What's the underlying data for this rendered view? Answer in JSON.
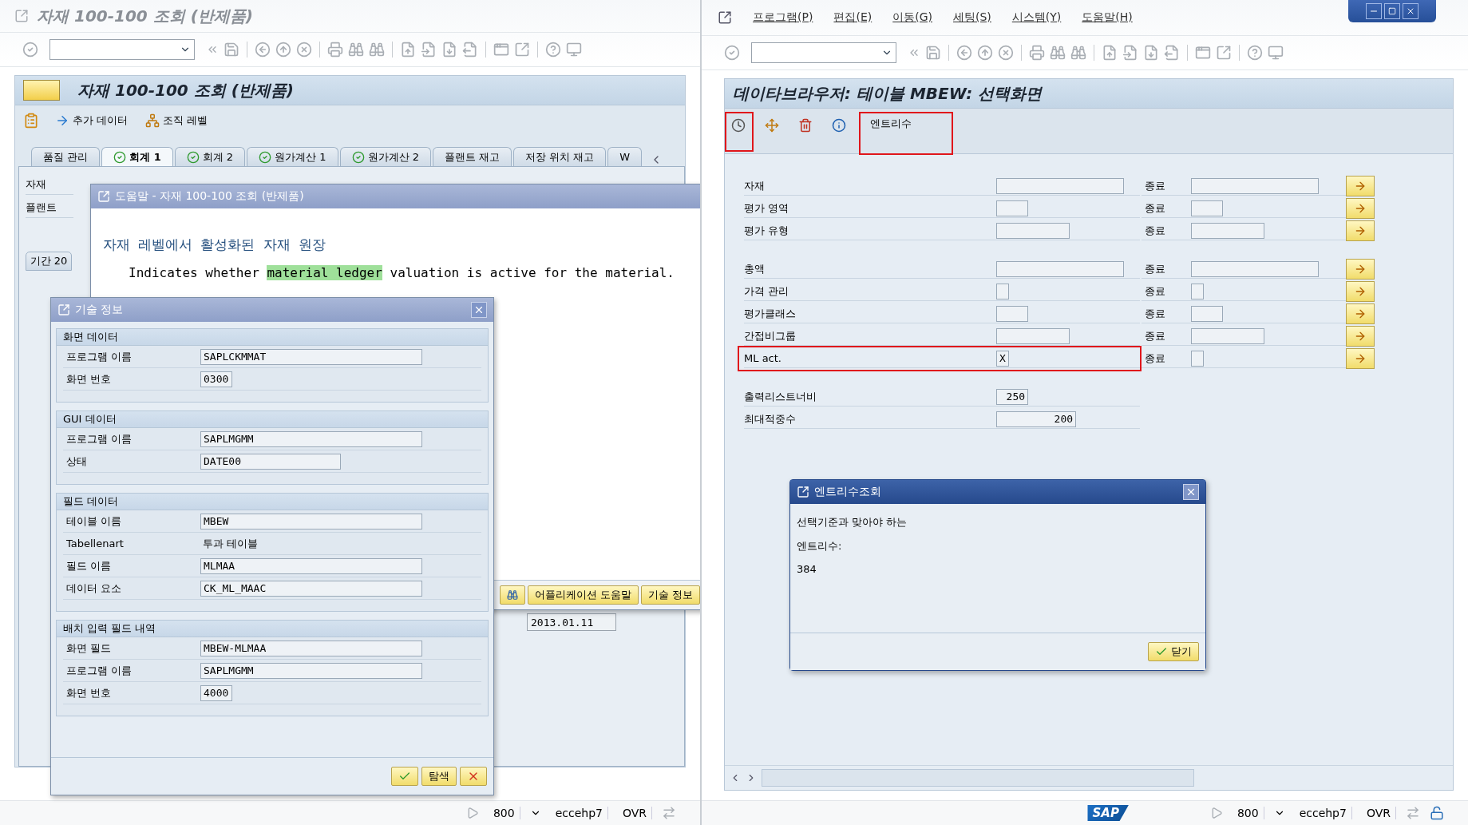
{
  "left_window": {
    "title": "자재 100-100 조회 (반제품)",
    "screen_title": "자재 100-100 조회 (반제품)",
    "app_toolbar": [
      {
        "kind": "arrow",
        "label": "추가 데이터"
      },
      {
        "kind": "org",
        "label": "조직 레벨"
      }
    ],
    "tabs": [
      {
        "label": "품질 관리",
        "selected": false,
        "checked": false
      },
      {
        "label": "회계 1",
        "selected": true,
        "checked": true
      },
      {
        "label": "회계 2",
        "selected": false,
        "checked": true
      },
      {
        "label": "원가계산 1",
        "selected": false,
        "checked": true
      },
      {
        "label": "원가계산 2",
        "selected": false,
        "checked": true
      },
      {
        "label": "플랜트 재고",
        "selected": false,
        "checked": false
      },
      {
        "label": "저장 위치 재고",
        "selected": false,
        "checked": false
      },
      {
        "label": "W",
        "selected": false,
        "checked": false
      }
    ],
    "fields": [
      "자재",
      "플랜트"
    ],
    "subtab": "기간 20",
    "date_value": "2013.01.11",
    "status_bar": {
      "client": "800",
      "system": "eccehp7",
      "mode": "OVR"
    }
  },
  "help_dialog": {
    "title": "도움말 - 자재 100-100 조회 (반제품)",
    "heading": "자재 레벨에서 활성화된 자재 원장",
    "text_before": "Indicates whether ",
    "highlight": "material ledger",
    "text_after": " valuation is active for the material.",
    "buttons": [
      {
        "kind": "binoculars"
      },
      {
        "kind": "text",
        "label": "어플리케이션 도움말"
      },
      {
        "kind": "text",
        "label": "기술 정보"
      }
    ]
  },
  "tech_dialog": {
    "title": "기술 정보",
    "sections": [
      {
        "title": "화면 데이터",
        "rows": [
          {
            "label": "프로그램 이름",
            "value": "SAPLCKMMAT",
            "kind": "long"
          },
          {
            "label": "화면 번호",
            "value": "0300",
            "kind": "short"
          }
        ]
      },
      {
        "title": "GUI 데이터",
        "rows": [
          {
            "label": "프로그램 이름",
            "value": "SAPLMGMM",
            "kind": "long"
          },
          {
            "label": "상태",
            "value": "DATE00",
            "kind": "medium"
          }
        ]
      },
      {
        "title": "필드 데이터",
        "rows": [
          {
            "label": "테이블 이름",
            "value": "MBEW",
            "kind": "long"
          },
          {
            "label": "Tabellenart",
            "value": "투과 테이블",
            "kind": "plain"
          },
          {
            "label": "필드 이름",
            "value": "MLMAA",
            "kind": "long"
          },
          {
            "label": "데이터 요소",
            "value": "CK_ML_MAAC",
            "kind": "long"
          }
        ]
      },
      {
        "title": "배치 입력 필드 내역",
        "rows": [
          {
            "label": "화면 필드",
            "value": "MBEW-MLMAA",
            "kind": "long"
          },
          {
            "label": "프로그램 이름",
            "value": "SAPLMGMM",
            "kind": "long"
          },
          {
            "label": "화면 번호",
            "value": "4000",
            "kind": "short"
          }
        ]
      }
    ],
    "buttons": [
      {
        "kind": "confirm"
      },
      {
        "kind": "text",
        "label": "탐색"
      },
      {
        "kind": "cancel"
      }
    ]
  },
  "right_window": {
    "menu": [
      "프로그램(P)",
      "편집(E)",
      "이동(G)",
      "세팅(S)",
      "시스템(Y)",
      "도움말(H)"
    ],
    "screen_title": "데이타브라우저: 테이블 MBEW: 선택화면",
    "toolbar": [
      {
        "kind": "execute",
        "highlighted": true
      },
      {
        "kind": "fields",
        "highlighted": false
      },
      {
        "kind": "delete",
        "highlighted": false
      },
      {
        "kind": "info",
        "highlighted": false
      },
      {
        "kind": "text",
        "label": "엔트리수",
        "highlighted": true
      }
    ],
    "criteria_groups": [
      [
        {
          "label": "자재",
          "kind": "long",
          "to_label": "종료",
          "highlighted": false
        },
        {
          "label": "평가 영역",
          "kind": "short",
          "to_label": "종료",
          "highlighted": false
        },
        {
          "label": "평가 유형",
          "kind": "medium",
          "to_label": "종료",
          "highlighted": false
        }
      ],
      [
        {
          "label": "총액",
          "kind": "long",
          "to_label": "종료",
          "highlighted": false
        },
        {
          "label": "가격 관리",
          "kind": "tiny",
          "to_label": "종료",
          "highlighted": false
        },
        {
          "label": "평가클래스",
          "kind": "short",
          "to_label": "종료",
          "highlighted": false
        },
        {
          "label": "간접비그룹",
          "kind": "medium",
          "to_label": "종료",
          "highlighted": false
        },
        {
          "label": "ML act.",
          "kind": "tiny",
          "value": "X",
          "to_label": "종료",
          "highlighted": true
        }
      ]
    ],
    "settings": [
      {
        "label": "출력리스트너비",
        "value": "250",
        "kind": "short"
      },
      {
        "label": "최대적중수",
        "value": "200",
        "kind": "medium"
      }
    ],
    "status_bar": {
      "logo": "SAP",
      "client": "800",
      "system": "eccehp7",
      "mode": "OVR"
    }
  },
  "count_dialog": {
    "title": "엔트리수조회",
    "message": "선택기준과 맞아야 하는",
    "label": "엔트리수:",
    "count": "384",
    "button": "닫기"
  }
}
